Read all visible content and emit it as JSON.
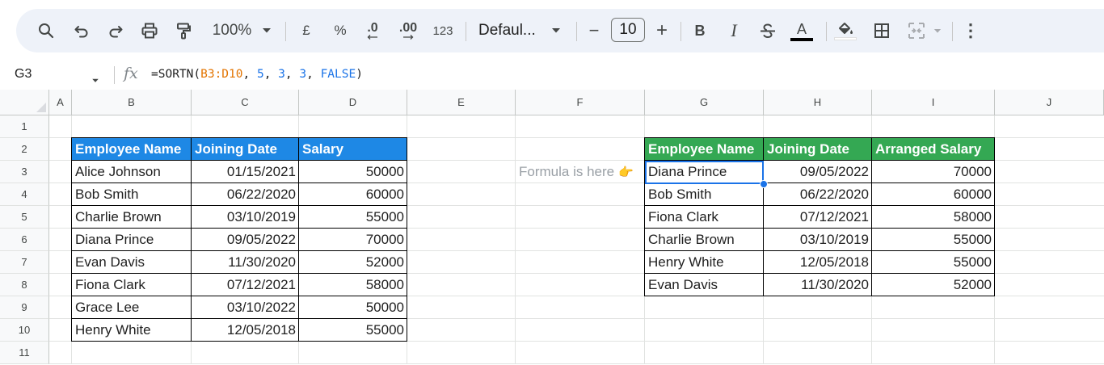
{
  "toolbar": {
    "zoom": "100%",
    "currency_symbol": "£",
    "percent_symbol": "%",
    "decrease_decimal": ".0",
    "increase_decimal": ".00",
    "more_formats": "123",
    "font_name": "Defaul...",
    "font_size": "10",
    "minus": "−",
    "plus": "+",
    "bold": "B",
    "italic": "I",
    "text_color_letter": "A",
    "more_label": "⋮"
  },
  "formula_bar": {
    "name_box": "G3",
    "fx": "fx",
    "formula_prefix": "=SORTN(",
    "formula_range": "B3:D10",
    "formula_sep1": ", ",
    "formula_n": "5",
    "formula_sep2": ", ",
    "formula_tie": "3",
    "formula_sep3": ", ",
    "formula_col": "3",
    "formula_sep4": ", ",
    "formula_order": "FALSE",
    "formula_suffix": ")"
  },
  "columns": [
    "A",
    "B",
    "C",
    "D",
    "E",
    "F",
    "G",
    "H",
    "I",
    "J"
  ],
  "rows": [
    "1",
    "2",
    "3",
    "4",
    "5",
    "6",
    "7",
    "8",
    "9",
    "10",
    "11"
  ],
  "colors": {
    "source_header_bg": "#1e88e5",
    "result_header_bg": "#34a853",
    "selection": "#1a73e8"
  },
  "source_table": {
    "headers": [
      "Employee Name",
      "Joining Date",
      "Salary"
    ],
    "rows": [
      [
        "Alice Johnson",
        "01/15/2021",
        "50000"
      ],
      [
        "Bob Smith",
        "06/22/2020",
        "60000"
      ],
      [
        "Charlie Brown",
        "03/10/2019",
        "55000"
      ],
      [
        "Diana Prince",
        "09/05/2022",
        "70000"
      ],
      [
        "Evan Davis",
        "11/30/2020",
        "52000"
      ],
      [
        "Fiona Clark",
        "07/12/2021",
        "58000"
      ],
      [
        "Grace Lee",
        "03/10/2022",
        "50000"
      ],
      [
        "Henry White",
        "12/05/2018",
        "55000"
      ]
    ]
  },
  "note": {
    "text": "Formula is here",
    "emoji": "👉"
  },
  "result_table": {
    "headers": [
      "Employee Name",
      "Joining Date",
      "Arranged Salary"
    ],
    "rows": [
      [
        "Diana Prince",
        "09/05/2022",
        "70000"
      ],
      [
        "Bob Smith",
        "06/22/2020",
        "60000"
      ],
      [
        "Fiona Clark",
        "07/12/2021",
        "58000"
      ],
      [
        "Charlie Brown",
        "03/10/2019",
        "55000"
      ],
      [
        "Henry White",
        "12/05/2018",
        "55000"
      ],
      [
        "Evan Davis",
        "11/30/2020",
        "52000"
      ]
    ]
  }
}
